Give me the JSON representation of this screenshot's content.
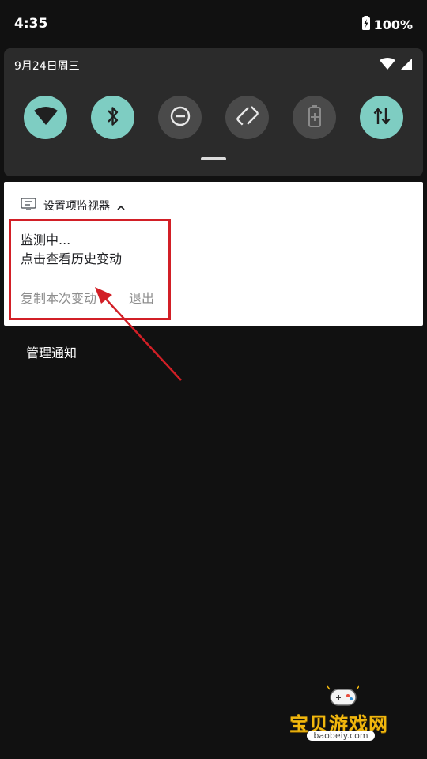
{
  "status_bar": {
    "time": "4:35",
    "battery_percent": "100%",
    "icons": [
      "battery-charging-icon"
    ]
  },
  "quick_settings": {
    "date": "9月24日周三",
    "signal_icons": [
      "wifi-icon",
      "cell-signal-icon"
    ],
    "tiles": [
      {
        "name": "wifi",
        "icon": "wifi-icon",
        "state": "on"
      },
      {
        "name": "bluetooth",
        "icon": "bluetooth-icon",
        "state": "on"
      },
      {
        "name": "do-not-disturb",
        "icon": "do-not-disturb-icon",
        "state": "off"
      },
      {
        "name": "auto-rotate",
        "icon": "auto-rotate-icon",
        "state": "off"
      },
      {
        "name": "battery-saver",
        "icon": "battery-saver-icon",
        "state": "off"
      },
      {
        "name": "mobile-data",
        "icon": "mobile-data-icon",
        "state": "on"
      }
    ]
  },
  "notification": {
    "app_name": "设置项监视器",
    "line1": "监测中...",
    "line2": "点击查看历史变动",
    "actions": {
      "copy": "复制本次变动",
      "exit": "退出"
    }
  },
  "manage_notifications": "管理通知",
  "watermark": {
    "title": "宝贝游戏网",
    "url": "baobeiy.com"
  },
  "colors": {
    "background": "#111111",
    "panel": "#2b2b2b",
    "tile_on": "#7ecdc2",
    "tile_off": "#4a4a4a",
    "annotation_red": "#d21f26"
  }
}
